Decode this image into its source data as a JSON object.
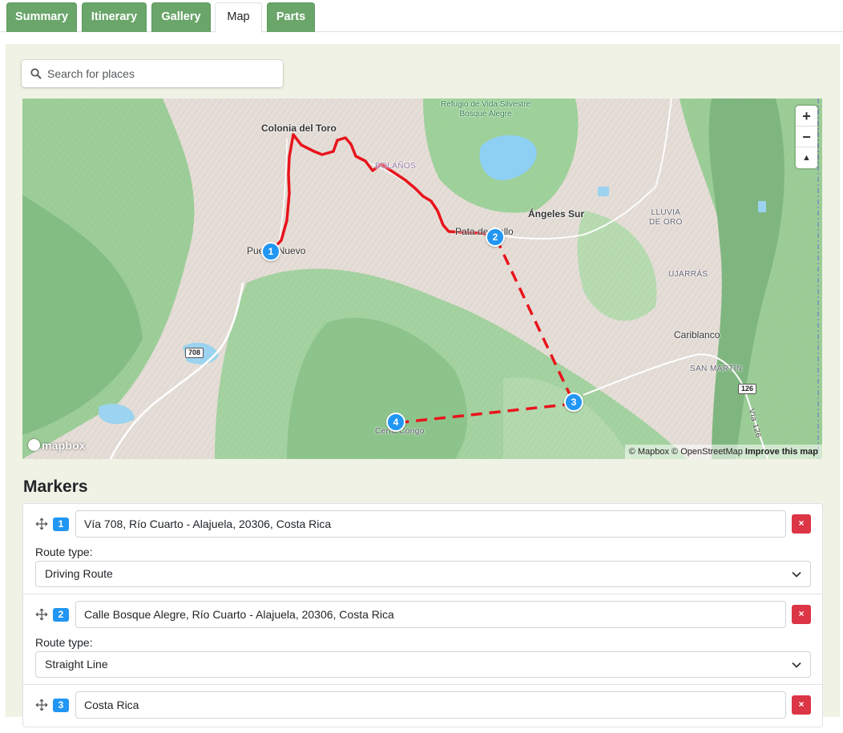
{
  "tabs": [
    {
      "label": "Summary",
      "active": false
    },
    {
      "label": "Itinerary",
      "active": false
    },
    {
      "label": "Gallery",
      "active": false
    },
    {
      "label": "Map",
      "active": true
    },
    {
      "label": "Parts",
      "active": false
    }
  ],
  "search": {
    "placeholder": "Search for places",
    "icon": "search-icon"
  },
  "map": {
    "labels": {
      "colonia": "Colonia del Toro",
      "refugio": "Refugio de Vida Silvestre\nBosque Alegre",
      "bolanos": "BOLAÑOS",
      "angeles": "Ángeles Sur",
      "lluvia": "LLUVIA\nDE ORO",
      "pata": "Pata de Gallo",
      "puerto": "Puerto Nuevo",
      "ujarras": "UJARRÁS",
      "cariblanco": "Cariblanco",
      "sanmartin": "SAN MARTÍN",
      "cerro": "Cerro Congo",
      "via126": "Vía 126"
    },
    "shields": {
      "r708": "708",
      "r126": "126"
    },
    "markers": [
      "1",
      "2",
      "3",
      "4"
    ],
    "controls": {
      "zoom_in": "+",
      "zoom_out": "−",
      "compass": "▲"
    },
    "logo": "mapbox",
    "attribution": {
      "text": "© Mapbox © OpenStreetMap",
      "improve": "Improve this map"
    },
    "colors": {
      "route": "#e8141c",
      "marker": "#2196f3"
    }
  },
  "markers_section": {
    "title": "Markers",
    "items": [
      {
        "number": "1",
        "address": "Vía 708, Río Cuarto - Alajuela, 20306, Costa Rica",
        "route_label": "Route type:",
        "route_type": "Driving Route",
        "delete": "×"
      },
      {
        "number": "2",
        "address": "Calle Bosque Alegre, Río Cuarto - Alajuela, 20306, Costa Rica",
        "route_label": "Route type:",
        "route_type": "Straight Line",
        "delete": "×"
      },
      {
        "number": "3",
        "address": "Costa Rica",
        "delete": "×"
      }
    ]
  }
}
